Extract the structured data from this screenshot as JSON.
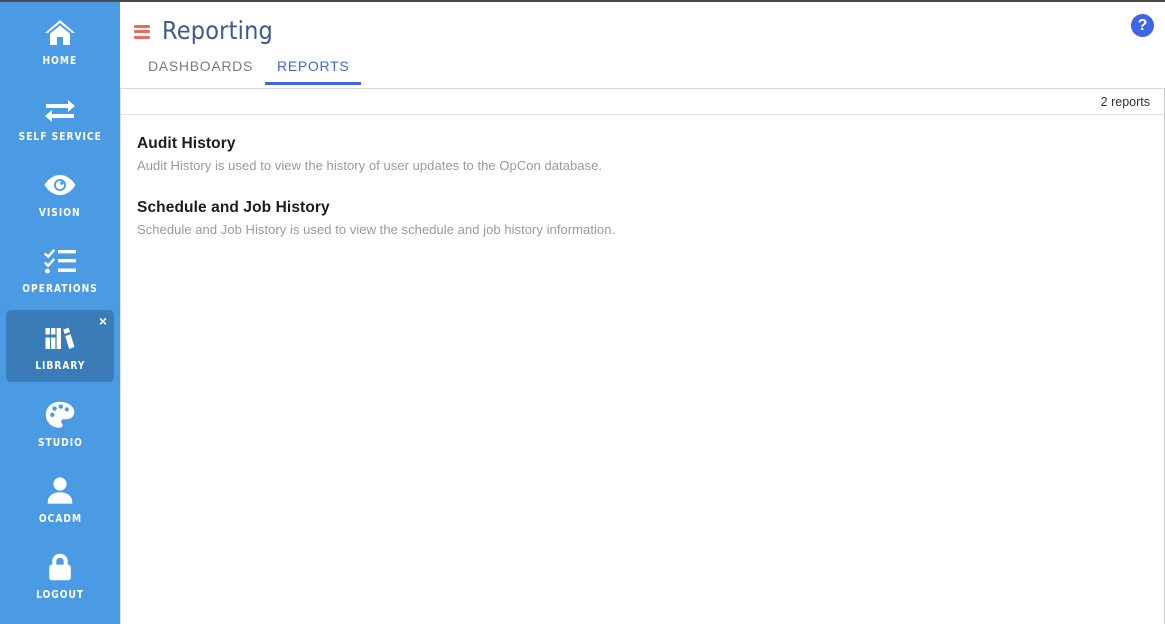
{
  "sidebar": {
    "background_color": "#4a9ae4",
    "active_color": "#3a7cb8",
    "items": [
      {
        "label": "HOME",
        "icon": "home-icon",
        "active": false
      },
      {
        "label": "SELF SERVICE",
        "icon": "exchange-icon",
        "active": false
      },
      {
        "label": "VISION",
        "icon": "eye-icon",
        "active": false
      },
      {
        "label": "OPERATIONS",
        "icon": "checklist-icon",
        "active": false
      },
      {
        "label": "LIBRARY",
        "icon": "books-icon",
        "active": true,
        "close_label": "×"
      },
      {
        "label": "STUDIO",
        "icon": "palette-icon",
        "active": false
      },
      {
        "label": "OCADM",
        "icon": "user-icon",
        "active": false
      },
      {
        "label": "LOGOUT",
        "icon": "lock-icon",
        "active": false
      }
    ]
  },
  "header": {
    "menu_icon": "hamburger-icon",
    "menu_icon_color": "#eb6a5a",
    "title": "Reporting",
    "title_color": "#3f5b8b",
    "help_icon": "help-icon",
    "help_label": "?",
    "help_color": "#3f65e4"
  },
  "tabs": [
    {
      "label": "DASHBOARDS",
      "active": false
    },
    {
      "label": "REPORTS",
      "active": true
    }
  ],
  "content": {
    "count_text": "2 reports",
    "reports": [
      {
        "name": "Audit History",
        "description": "Audit History is used to view the history of user updates to the OpCon database."
      },
      {
        "name": "Schedule and Job History",
        "description": "Schedule and Job History is used to view the schedule and job history information."
      }
    ]
  }
}
